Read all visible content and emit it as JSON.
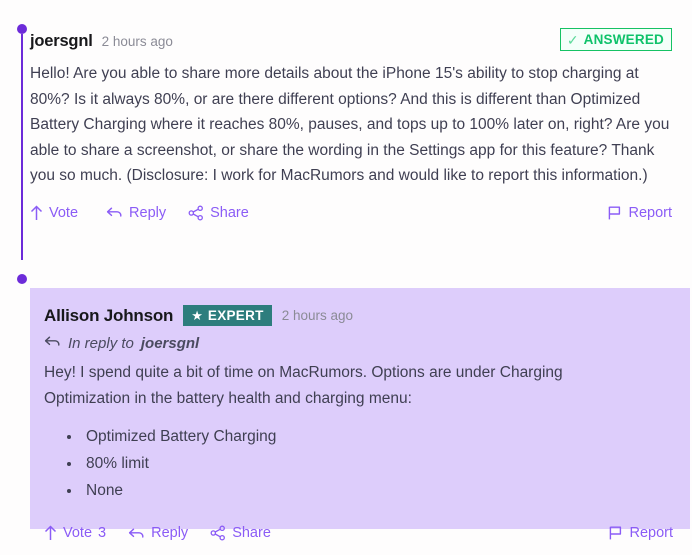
{
  "theme": {
    "accent_purple": "#8b5cf6",
    "thread_purple": "#6c2bd9",
    "reply_card_bg": "#ddcdfb",
    "answered_green": "#0ec26a",
    "expert_teal": "#2d7d7d",
    "page_bg": "#fefdfd"
  },
  "comments": [
    {
      "author": "joersgnl",
      "timestamp": "2 hours ago",
      "status_badge": {
        "label": "ANSWERED",
        "icon": "check-icon",
        "glyph": "✓"
      },
      "body": "Hello! Are you able to share more details about the iPhone 15's ability to stop charging at 80%? Is it always 80%, or are there different options? And this is different than Optimized Battery Charging where it reaches 80%, pauses, and tops up to 100% later on, right? Are you able to share a screenshot, or share the wording in the Settings app for this feature? Thank you so much. (Disclosure: I work for MacRumors and would like to report this information.)",
      "actions": {
        "vote": "Vote",
        "vote_count": "",
        "reply": "Reply",
        "share": "Share",
        "report": "Report"
      }
    },
    {
      "author": "Allison Johnson",
      "timestamp": "2 hours ago",
      "expert_badge": {
        "label": "EXPERT",
        "icon": "star-icon",
        "glyph": "★"
      },
      "in_reply_to_prefix": "In reply to",
      "in_reply_to_target": "joersgnl",
      "body": "Hey! I spend quite a bit of time on MacRumors. Options are under Charging Optimization in the battery health and charging menu:",
      "bullets": [
        "Optimized Battery Charging",
        "80% limit",
        "None"
      ],
      "actions": {
        "vote": "Vote",
        "vote_count": "3",
        "reply": "Reply",
        "share": "Share",
        "report": "Report"
      }
    }
  ]
}
